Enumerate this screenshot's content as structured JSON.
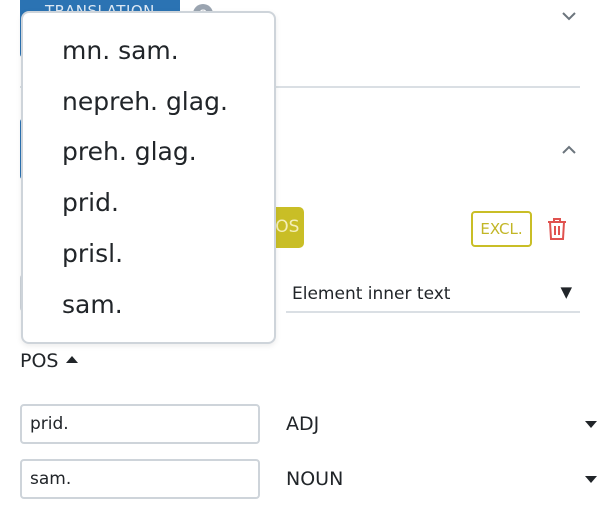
{
  "tabs": {
    "translation_label": "TRANSLATION"
  },
  "rule": {
    "pos_button_label": "POS",
    "excl_button_label": "EXCL.",
    "source_select_value": "Element inner text",
    "source_select_arrow": "▼"
  },
  "pos_section": {
    "title": "POS"
  },
  "pos_mappings": [
    {
      "input_value": "prid.",
      "tag": "ADJ"
    },
    {
      "input_value": "sam.",
      "tag": "NOUN"
    }
  ],
  "dropdown": {
    "items": [
      "mn. sam.",
      "nepreh. glag.",
      "preh. glag.",
      "prid.",
      "prisl.",
      "sam."
    ]
  },
  "colors": {
    "primary": "#2b73b3",
    "accent_olive": "#c9be26",
    "danger": "#e0524f",
    "border": "#ced4da"
  },
  "icons": {
    "help": "help-circle-icon",
    "collapse_top": "chevron-down-icon",
    "collapse_panel": "chevron-up-icon",
    "delete": "trash-icon"
  }
}
